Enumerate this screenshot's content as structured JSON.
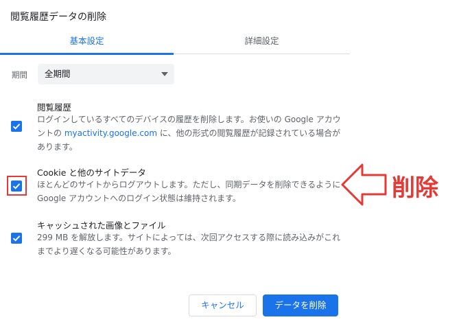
{
  "dialog": {
    "title": "閲覧履歴データの削除",
    "tabs": [
      {
        "label": "基本設定",
        "active": true
      },
      {
        "label": "詳細設定",
        "active": false
      }
    ],
    "period": {
      "label": "期間",
      "value": "全期間"
    },
    "items": [
      {
        "title": "閲覧履歴",
        "desc_before": "ログインしているすべてのデバイスの履歴を削除します。お使いの Google アカウントの ",
        "desc_link": "myactivity.google.com",
        "desc_after": " に、他の形式の閲覧履歴が記録されている場合があります。",
        "checked": true
      },
      {
        "title": "Cookie と他のサイトデータ",
        "desc": "ほとんどのサイトからログアウトします。ただし、同期データを削除できるように Google アカウントへのログイン状態は維持されます。",
        "checked": true
      },
      {
        "title": "キャッシュされた画像とファイル",
        "desc": "299 MB を解放します。サイトによっては、次回アクセスする際に読み込みがこれまでより遅くなる可能性があります。",
        "checked": true
      }
    ],
    "buttons": {
      "cancel": "キャンセル",
      "delete": "データを削除"
    }
  },
  "annotation": {
    "label": "削除",
    "color": "#e53935"
  },
  "colors": {
    "accent": "#1a73e8",
    "text": "#202124",
    "secondary": "#5f6368"
  }
}
